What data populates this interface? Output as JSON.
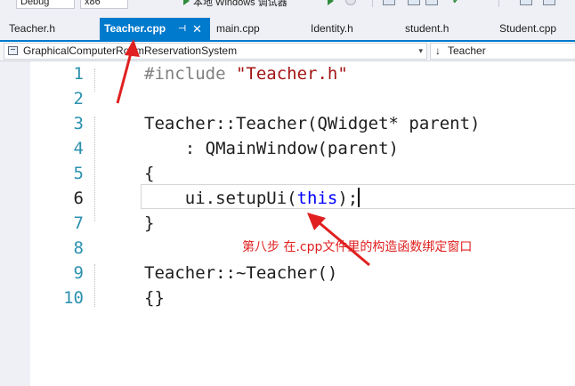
{
  "toolbar": {
    "config": "Debug",
    "platform": "x86",
    "run_label": "本地 Windows 调试器"
  },
  "tabs": [
    {
      "label": "Teacher.h",
      "active": false
    },
    {
      "label": "Teacher.cpp",
      "active": true
    },
    {
      "label": "main.cpp",
      "active": false
    },
    {
      "label": "Identity.h",
      "active": false
    },
    {
      "label": "student.h",
      "active": false
    },
    {
      "label": "Student.cpp",
      "active": false
    }
  ],
  "navbar": {
    "project": "GraphicalComputerRoomReservationSystem",
    "scope": "Teacher",
    "scope_icon": "↓"
  },
  "editor": {
    "current_line": 6,
    "lines": [
      {
        "num": "1",
        "tokens": [
          {
            "t": "#include ",
            "c": "kw-pre"
          },
          {
            "t": "\"Teacher.h\"",
            "c": "str"
          }
        ]
      },
      {
        "num": "2",
        "tokens": []
      },
      {
        "num": "3",
        "tokens": [
          {
            "t": "Teacher::Teacher(QWidget* parent)",
            "c": ""
          }
        ]
      },
      {
        "num": "4",
        "tokens": [
          {
            "t": "    : QMainWindow(parent)",
            "c": ""
          }
        ]
      },
      {
        "num": "5",
        "tokens": [
          {
            "t": "{",
            "c": ""
          }
        ]
      },
      {
        "num": "6",
        "tokens": [
          {
            "t": "    ui.setupUi(",
            "c": ""
          },
          {
            "t": "this",
            "c": "kw"
          },
          {
            "t": ");",
            "c": ""
          }
        ]
      },
      {
        "num": "7",
        "tokens": [
          {
            "t": "}",
            "c": ""
          }
        ]
      },
      {
        "num": "8",
        "tokens": []
      },
      {
        "num": "9",
        "tokens": [
          {
            "t": "Teacher::~Teacher()",
            "c": ""
          }
        ]
      },
      {
        "num": "10",
        "tokens": [
          {
            "t": "{}",
            "c": ""
          }
        ]
      }
    ]
  },
  "annotation": "第八步 在.cpp文件里的构造函数绑定窗口",
  "colors": {
    "accent": "#007acc",
    "annotation": "#e02020",
    "line_number": "#2b91af",
    "string": "#a31515",
    "keyword": "#0000ff"
  }
}
